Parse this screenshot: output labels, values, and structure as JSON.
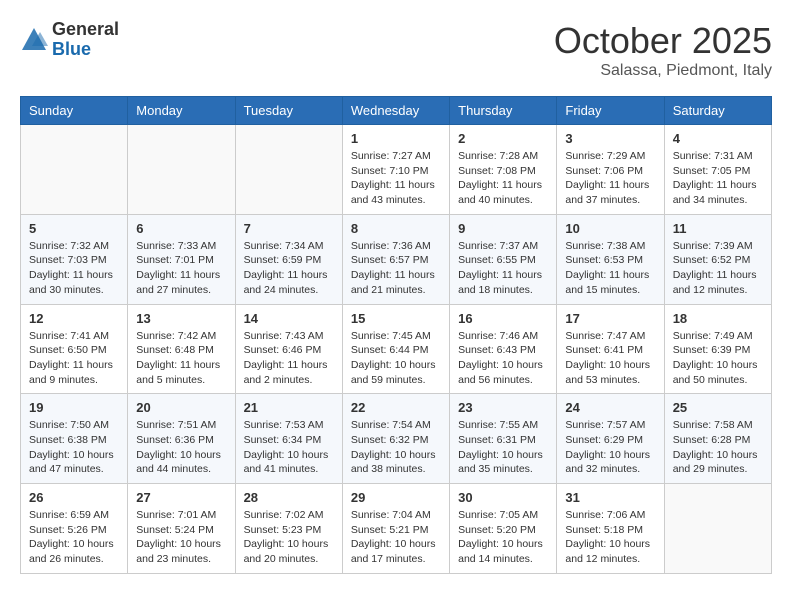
{
  "header": {
    "logo_general": "General",
    "logo_blue": "Blue",
    "month_title": "October 2025",
    "location": "Salassa, Piedmont, Italy"
  },
  "weekdays": [
    "Sunday",
    "Monday",
    "Tuesday",
    "Wednesday",
    "Thursday",
    "Friday",
    "Saturday"
  ],
  "weeks": [
    [
      {
        "day": "",
        "info": ""
      },
      {
        "day": "",
        "info": ""
      },
      {
        "day": "",
        "info": ""
      },
      {
        "day": "1",
        "info": "Sunrise: 7:27 AM\nSunset: 7:10 PM\nDaylight: 11 hours\nand 43 minutes."
      },
      {
        "day": "2",
        "info": "Sunrise: 7:28 AM\nSunset: 7:08 PM\nDaylight: 11 hours\nand 40 minutes."
      },
      {
        "day": "3",
        "info": "Sunrise: 7:29 AM\nSunset: 7:06 PM\nDaylight: 11 hours\nand 37 minutes."
      },
      {
        "day": "4",
        "info": "Sunrise: 7:31 AM\nSunset: 7:05 PM\nDaylight: 11 hours\nand 34 minutes."
      }
    ],
    [
      {
        "day": "5",
        "info": "Sunrise: 7:32 AM\nSunset: 7:03 PM\nDaylight: 11 hours\nand 30 minutes."
      },
      {
        "day": "6",
        "info": "Sunrise: 7:33 AM\nSunset: 7:01 PM\nDaylight: 11 hours\nand 27 minutes."
      },
      {
        "day": "7",
        "info": "Sunrise: 7:34 AM\nSunset: 6:59 PM\nDaylight: 11 hours\nand 24 minutes."
      },
      {
        "day": "8",
        "info": "Sunrise: 7:36 AM\nSunset: 6:57 PM\nDaylight: 11 hours\nand 21 minutes."
      },
      {
        "day": "9",
        "info": "Sunrise: 7:37 AM\nSunset: 6:55 PM\nDaylight: 11 hours\nand 18 minutes."
      },
      {
        "day": "10",
        "info": "Sunrise: 7:38 AM\nSunset: 6:53 PM\nDaylight: 11 hours\nand 15 minutes."
      },
      {
        "day": "11",
        "info": "Sunrise: 7:39 AM\nSunset: 6:52 PM\nDaylight: 11 hours\nand 12 minutes."
      }
    ],
    [
      {
        "day": "12",
        "info": "Sunrise: 7:41 AM\nSunset: 6:50 PM\nDaylight: 11 hours\nand 9 minutes."
      },
      {
        "day": "13",
        "info": "Sunrise: 7:42 AM\nSunset: 6:48 PM\nDaylight: 11 hours\nand 5 minutes."
      },
      {
        "day": "14",
        "info": "Sunrise: 7:43 AM\nSunset: 6:46 PM\nDaylight: 11 hours\nand 2 minutes."
      },
      {
        "day": "15",
        "info": "Sunrise: 7:45 AM\nSunset: 6:44 PM\nDaylight: 10 hours\nand 59 minutes."
      },
      {
        "day": "16",
        "info": "Sunrise: 7:46 AM\nSunset: 6:43 PM\nDaylight: 10 hours\nand 56 minutes."
      },
      {
        "day": "17",
        "info": "Sunrise: 7:47 AM\nSunset: 6:41 PM\nDaylight: 10 hours\nand 53 minutes."
      },
      {
        "day": "18",
        "info": "Sunrise: 7:49 AM\nSunset: 6:39 PM\nDaylight: 10 hours\nand 50 minutes."
      }
    ],
    [
      {
        "day": "19",
        "info": "Sunrise: 7:50 AM\nSunset: 6:38 PM\nDaylight: 10 hours\nand 47 minutes."
      },
      {
        "day": "20",
        "info": "Sunrise: 7:51 AM\nSunset: 6:36 PM\nDaylight: 10 hours\nand 44 minutes."
      },
      {
        "day": "21",
        "info": "Sunrise: 7:53 AM\nSunset: 6:34 PM\nDaylight: 10 hours\nand 41 minutes."
      },
      {
        "day": "22",
        "info": "Sunrise: 7:54 AM\nSunset: 6:32 PM\nDaylight: 10 hours\nand 38 minutes."
      },
      {
        "day": "23",
        "info": "Sunrise: 7:55 AM\nSunset: 6:31 PM\nDaylight: 10 hours\nand 35 minutes."
      },
      {
        "day": "24",
        "info": "Sunrise: 7:57 AM\nSunset: 6:29 PM\nDaylight: 10 hours\nand 32 minutes."
      },
      {
        "day": "25",
        "info": "Sunrise: 7:58 AM\nSunset: 6:28 PM\nDaylight: 10 hours\nand 29 minutes."
      }
    ],
    [
      {
        "day": "26",
        "info": "Sunrise: 6:59 AM\nSunset: 5:26 PM\nDaylight: 10 hours\nand 26 minutes."
      },
      {
        "day": "27",
        "info": "Sunrise: 7:01 AM\nSunset: 5:24 PM\nDaylight: 10 hours\nand 23 minutes."
      },
      {
        "day": "28",
        "info": "Sunrise: 7:02 AM\nSunset: 5:23 PM\nDaylight: 10 hours\nand 20 minutes."
      },
      {
        "day": "29",
        "info": "Sunrise: 7:04 AM\nSunset: 5:21 PM\nDaylight: 10 hours\nand 17 minutes."
      },
      {
        "day": "30",
        "info": "Sunrise: 7:05 AM\nSunset: 5:20 PM\nDaylight: 10 hours\nand 14 minutes."
      },
      {
        "day": "31",
        "info": "Sunrise: 7:06 AM\nSunset: 5:18 PM\nDaylight: 10 hours\nand 12 minutes."
      },
      {
        "day": "",
        "info": ""
      }
    ]
  ]
}
